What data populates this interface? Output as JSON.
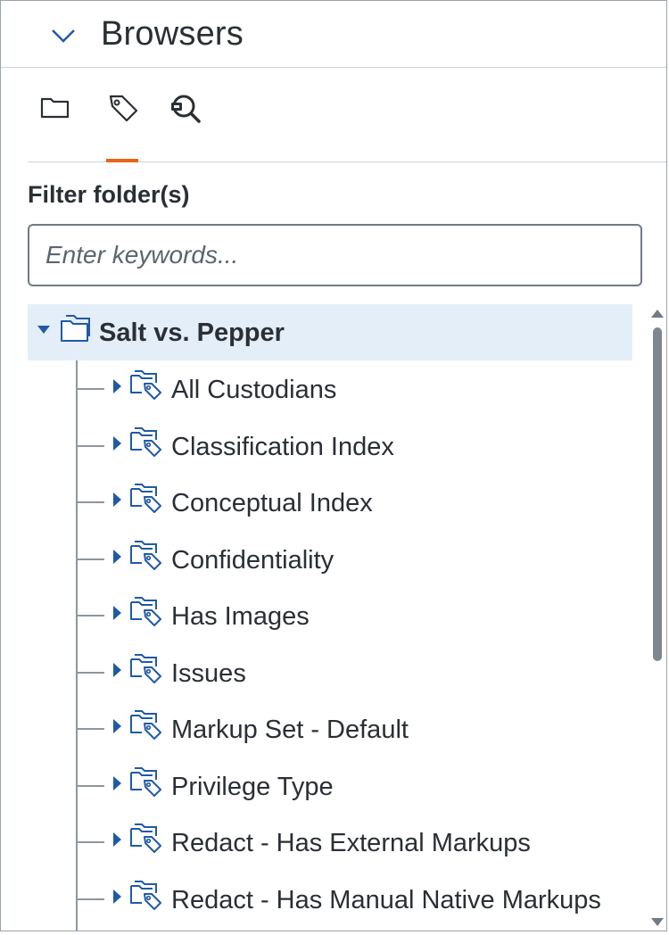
{
  "header": {
    "title": "Browsers",
    "collapse_icon": "chevron-down-icon"
  },
  "tabs": [
    {
      "icon": "folder-icon",
      "active": false
    },
    {
      "icon": "tag-icon",
      "active": true
    },
    {
      "icon": "search-field-icon",
      "active": false
    }
  ],
  "filter": {
    "label": "Filter folder(s)",
    "placeholder": "Enter keywords...",
    "value": ""
  },
  "tree": {
    "root": {
      "label": "Salt vs. Pepper",
      "expanded": true,
      "icon": "folder-outline-icon"
    },
    "children": [
      {
        "label": "All Custodians"
      },
      {
        "label": "Classification Index"
      },
      {
        "label": "Conceptual Index"
      },
      {
        "label": "Confidentiality"
      },
      {
        "label": "Has Images"
      },
      {
        "label": "Issues"
      },
      {
        "label": "Markup Set - Default"
      },
      {
        "label": "Privilege Type"
      },
      {
        "label": "Redact - Has External Markups"
      },
      {
        "label": "Redact - Has Manual Native Markups"
      }
    ],
    "child_icon": "tag-folder-icon"
  },
  "colors": {
    "accent": "#e8641b",
    "icon_blue": "#1f5aa6",
    "selected_row": "#e4eef8",
    "text": "#2a2f36"
  }
}
